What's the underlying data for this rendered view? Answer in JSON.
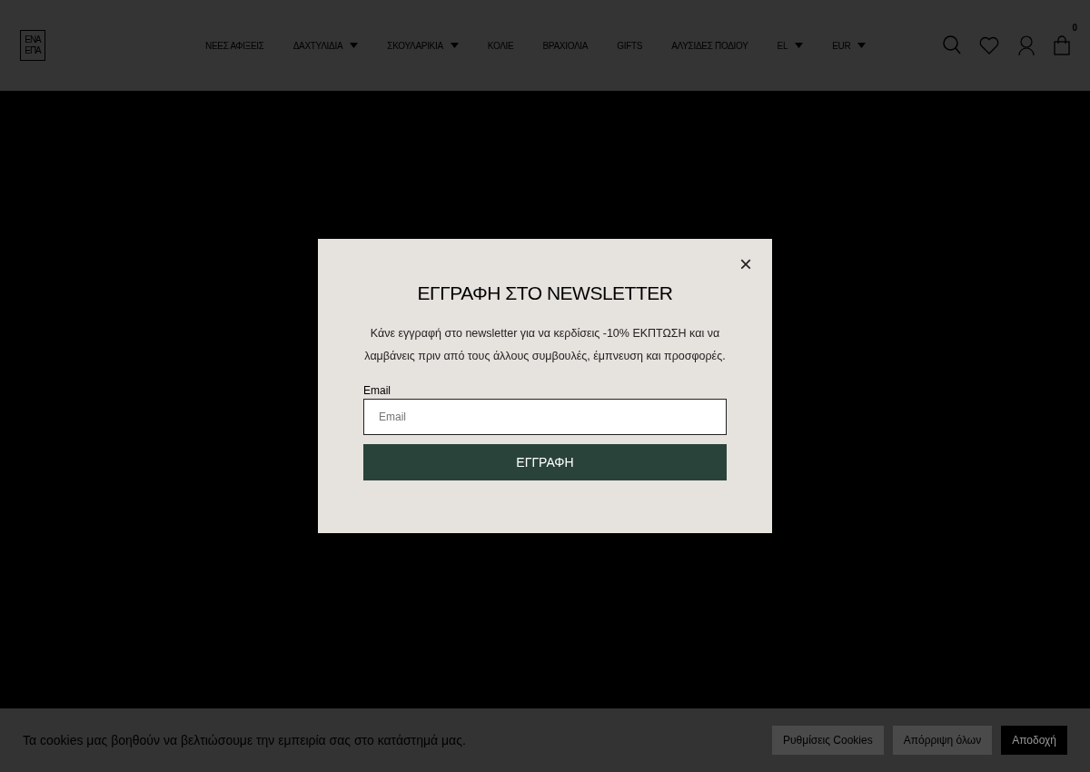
{
  "header": {
    "logo": [
      "ΕΝΑ",
      "ΕΠΑ"
    ],
    "menu": [
      {
        "label": "ΝΕΕΣ ΑΦΙΞΕΙΣ",
        "dropdown": false
      },
      {
        "label": "ΔΑΧΤΥΛΙΔΙΑ",
        "dropdown": true
      },
      {
        "label": "ΣΚΟΥΛΑΡΙΚΙΑ",
        "dropdown": true
      },
      {
        "label": "ΚΟΛΙΕ",
        "dropdown": false
      },
      {
        "label": "ΒΡΑΧΙΟΛΙΑ",
        "dropdown": false
      },
      {
        "label": "GIFTS",
        "dropdown": false
      },
      {
        "label": "ΑΛΥΣΙΔΕΣ ΠΟΔΙΟΥ",
        "dropdown": false
      },
      {
        "label": "EL",
        "dropdown": true
      },
      {
        "label": "EUR",
        "dropdown": true
      }
    ],
    "cart_count": "0"
  },
  "popup": {
    "close": "×",
    "title": "ΕΓΓΡΑΦΗ ΣΤΟ NEWSLETTER",
    "text": "Κάνε εγγραφή στο newsletter για να κερδίσεις -10% ΕΚΠΤΩΣΗ και να λαμβάνεις πριν από τους άλλους συμβουλές, έμπνευση και προσφορές.",
    "field_label": "Email",
    "placeholder": "Email",
    "button": "ΕΓΓΡΑΦΗ"
  },
  "cookie_bar": {
    "text": "Τα cookies μας βοηθούν να βελτιώσουμε την εμπειρία σας στο κατάστημά μας.",
    "buttons": [
      {
        "label": "Ρυθμίσεις Cookies",
        "kind": "secondary"
      },
      {
        "label": "Απόρριψη όλων",
        "kind": "secondary"
      },
      {
        "label": "Αποδοχή",
        "kind": "primary"
      }
    ]
  }
}
